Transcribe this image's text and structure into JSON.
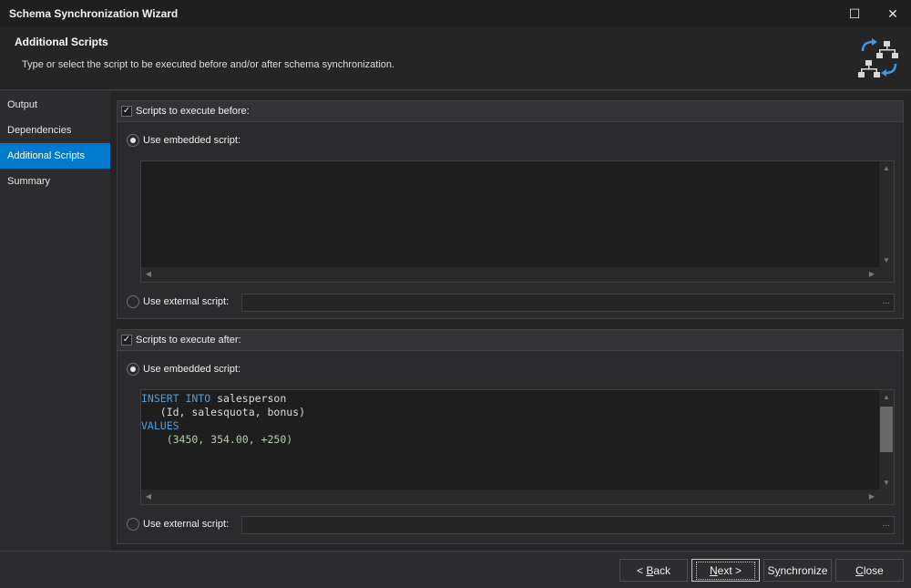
{
  "window": {
    "title": "Schema Synchronization Wizard",
    "maximize_glyph": "☐",
    "close_glyph": "✕"
  },
  "header": {
    "title": "Additional Scripts",
    "description": "Type or select the script to be executed before and/or after schema synchronization.",
    "icon": "schema-sync-icon"
  },
  "sidebar": {
    "items": [
      {
        "label": "Output",
        "active": false
      },
      {
        "label": "Dependencies",
        "active": false
      },
      {
        "label": "Additional Scripts",
        "active": true
      },
      {
        "label": "Summary",
        "active": false
      }
    ]
  },
  "before": {
    "group_label": "Scripts to execute before:",
    "checked": true,
    "embedded_label": "Use embedded script:",
    "embedded_selected": true,
    "code": "",
    "external_label": "Use external script:",
    "external_value": "",
    "browse_label": "..."
  },
  "after": {
    "group_label": "Scripts to execute after:",
    "checked": true,
    "embedded_label": "Use embedded script:",
    "embedded_selected": true,
    "code_lines": [
      {
        "parts": [
          {
            "t": "INSERT INTO",
            "c": "kw"
          },
          {
            "t": " salesperson",
            "c": ""
          }
        ]
      },
      {
        "parts": [
          {
            "t": "   (Id, salesquota, bonus)",
            "c": ""
          }
        ]
      },
      {
        "parts": [
          {
            "t": "VALUES",
            "c": "kw"
          }
        ]
      },
      {
        "parts": [
          {
            "t": "    (3450, 354.00, +250)",
            "c": "num"
          }
        ]
      }
    ],
    "external_label": "Use external script:",
    "external_value": "",
    "browse_label": "..."
  },
  "footer": {
    "back_prefix": "< ",
    "back_mnemonic": "B",
    "back_rest": "ack",
    "next_mnemonic": "N",
    "next_rest": "ext >",
    "sync_prefix": "S",
    "sync_mnemonic": "y",
    "sync_rest": "nchronize",
    "close_mnemonic": "C",
    "close_rest": "lose"
  },
  "colors": {
    "accent": "#007acc",
    "keyword": "#569cd6",
    "number": "#b5cea8",
    "background": "#2d2d30"
  }
}
